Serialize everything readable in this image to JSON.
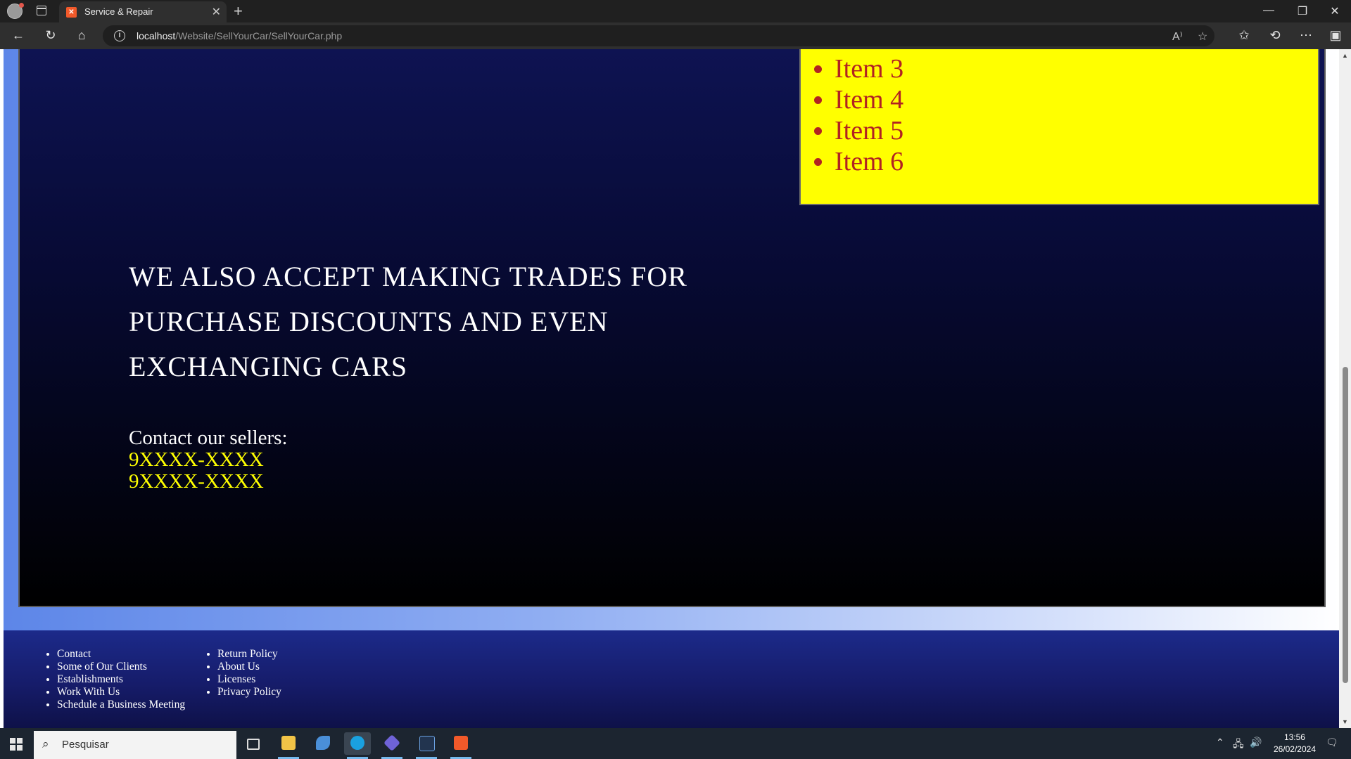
{
  "browser": {
    "tab_title": "Service & Repair",
    "tab_favicon": "xampp-icon",
    "url_host": "localhost",
    "url_path": "/Website/SellYourCar/SellYourCar.php"
  },
  "page": {
    "items": [
      "Item 3",
      "Item 4",
      "Item 5",
      "Item 6"
    ],
    "heading_lines": [
      "WE ALSO ACCEPT MAKING TRADES FOR",
      "PURCHASE DISCOUNTS AND EVEN",
      "EXCHANGING CARS"
    ],
    "contact_label": "Contact our sellers:",
    "phones": [
      "9XXXX-XXXX",
      "9XXXX-XXXX"
    ]
  },
  "footer": {
    "column1": [
      "Contact",
      "Some of Our Clients",
      "Establishments",
      "Work With Us",
      "Schedule a Business Meeting"
    ],
    "column2": [
      "Return Policy",
      "About Us",
      "Licenses",
      "Privacy Policy"
    ]
  },
  "taskbar": {
    "search_placeholder": "Pesquisar",
    "time": "13:56",
    "date": "26/02/2024"
  },
  "colors": {
    "item_box_bg": "#ffff00",
    "item_text": "#b22222",
    "phone_text": "#ffff00",
    "hero_top": "#0e1352",
    "footer_bg": "#161c6a"
  }
}
